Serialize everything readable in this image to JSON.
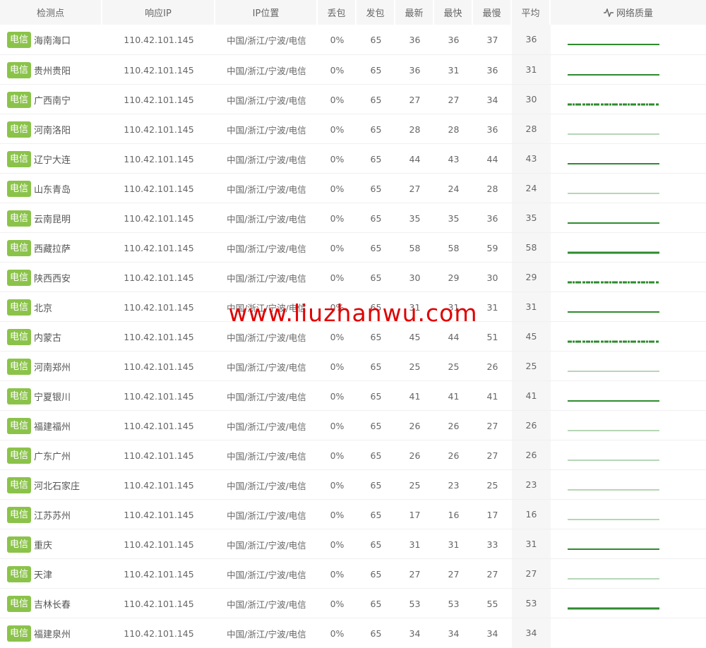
{
  "header": {
    "node": "检测点",
    "ip": "响应IP",
    "location": "IP位置",
    "loss": "丢包",
    "sent": "发包",
    "latest": "最新",
    "fastest": "最快",
    "slowest": "最慢",
    "average": "平均",
    "quality": "网络质量",
    "quality_icon": "pulse-icon"
  },
  "colors": {
    "badge": "#8bc34a",
    "quality_line": "#2e8b2e",
    "watermark": "#e00000",
    "header_bg": "#f6f6f6"
  },
  "watermark": "www.liuzhanwu.com",
  "rows": [
    {
      "isp": "电信",
      "node": "海南海口",
      "ip": "110.42.101.145",
      "location": "中国/浙江/宁波/电信",
      "loss": "0%",
      "sent": "65",
      "latest": "36",
      "fastest": "36",
      "slowest": "37",
      "average": "36",
      "quality": "solid"
    },
    {
      "isp": "电信",
      "node": "贵州贵阳",
      "ip": "110.42.101.145",
      "location": "中国/浙江/宁波/电信",
      "loss": "0%",
      "sent": "65",
      "latest": "36",
      "fastest": "31",
      "slowest": "36",
      "average": "31",
      "quality": "solid"
    },
    {
      "isp": "电信",
      "node": "广西南宁",
      "ip": "110.42.101.145",
      "location": "中国/浙江/宁波/电信",
      "loss": "0%",
      "sent": "65",
      "latest": "27",
      "fastest": "27",
      "slowest": "34",
      "average": "30",
      "quality": "jitter"
    },
    {
      "isp": "电信",
      "node": "河南洛阳",
      "ip": "110.42.101.145",
      "location": "中国/浙江/宁波/电信",
      "loss": "0%",
      "sent": "65",
      "latest": "28",
      "fastest": "28",
      "slowest": "36",
      "average": "28",
      "quality": "thin"
    },
    {
      "isp": "电信",
      "node": "辽宁大连",
      "ip": "110.42.101.145",
      "location": "中国/浙江/宁波/电信",
      "loss": "0%",
      "sent": "65",
      "latest": "44",
      "fastest": "43",
      "slowest": "44",
      "average": "43",
      "quality": "solid"
    },
    {
      "isp": "电信",
      "node": "山东青岛",
      "ip": "110.42.101.145",
      "location": "中国/浙江/宁波/电信",
      "loss": "0%",
      "sent": "65",
      "latest": "27",
      "fastest": "24",
      "slowest": "28",
      "average": "24",
      "quality": "thin"
    },
    {
      "isp": "电信",
      "node": "云南昆明",
      "ip": "110.42.101.145",
      "location": "中国/浙江/宁波/电信",
      "loss": "0%",
      "sent": "65",
      "latest": "35",
      "fastest": "35",
      "slowest": "36",
      "average": "35",
      "quality": "solid"
    },
    {
      "isp": "电信",
      "node": "西藏拉萨",
      "ip": "110.42.101.145",
      "location": "中国/浙江/宁波/电信",
      "loss": "0%",
      "sent": "65",
      "latest": "58",
      "fastest": "58",
      "slowest": "59",
      "average": "58",
      "quality": "thick"
    },
    {
      "isp": "电信",
      "node": "陕西西安",
      "ip": "110.42.101.145",
      "location": "中国/浙江/宁波/电信",
      "loss": "0%",
      "sent": "65",
      "latest": "30",
      "fastest": "29",
      "slowest": "30",
      "average": "29",
      "quality": "jitter"
    },
    {
      "isp": "电信",
      "node": "北京",
      "ip": "110.42.101.145",
      "location": "中国/浙江/宁波/电信",
      "loss": "0%",
      "sent": "65",
      "latest": "31",
      "fastest": "31",
      "slowest": "31",
      "average": "31",
      "quality": "solid"
    },
    {
      "isp": "电信",
      "node": "内蒙古",
      "ip": "110.42.101.145",
      "location": "中国/浙江/宁波/电信",
      "loss": "0%",
      "sent": "65",
      "latest": "45",
      "fastest": "44",
      "slowest": "51",
      "average": "45",
      "quality": "jitter"
    },
    {
      "isp": "电信",
      "node": "河南郑州",
      "ip": "110.42.101.145",
      "location": "中国/浙江/宁波/电信",
      "loss": "0%",
      "sent": "65",
      "latest": "25",
      "fastest": "25",
      "slowest": "26",
      "average": "25",
      "quality": "thin"
    },
    {
      "isp": "电信",
      "node": "宁夏银川",
      "ip": "110.42.101.145",
      "location": "中国/浙江/宁波/电信",
      "loss": "0%",
      "sent": "65",
      "latest": "41",
      "fastest": "41",
      "slowest": "41",
      "average": "41",
      "quality": "solid"
    },
    {
      "isp": "电信",
      "node": "福建福州",
      "ip": "110.42.101.145",
      "location": "中国/浙江/宁波/电信",
      "loss": "0%",
      "sent": "65",
      "latest": "26",
      "fastest": "26",
      "slowest": "27",
      "average": "26",
      "quality": "thin"
    },
    {
      "isp": "电信",
      "node": "广东广州",
      "ip": "110.42.101.145",
      "location": "中国/浙江/宁波/电信",
      "loss": "0%",
      "sent": "65",
      "latest": "26",
      "fastest": "26",
      "slowest": "27",
      "average": "26",
      "quality": "thin"
    },
    {
      "isp": "电信",
      "node": "河北石家庄",
      "ip": "110.42.101.145",
      "location": "中国/浙江/宁波/电信",
      "loss": "0%",
      "sent": "65",
      "latest": "25",
      "fastest": "23",
      "slowest": "25",
      "average": "23",
      "quality": "thin"
    },
    {
      "isp": "电信",
      "node": "江苏苏州",
      "ip": "110.42.101.145",
      "location": "中国/浙江/宁波/电信",
      "loss": "0%",
      "sent": "65",
      "latest": "17",
      "fastest": "16",
      "slowest": "17",
      "average": "16",
      "quality": "thin"
    },
    {
      "isp": "电信",
      "node": "重庆",
      "ip": "110.42.101.145",
      "location": "中国/浙江/宁波/电信",
      "loss": "0%",
      "sent": "65",
      "latest": "31",
      "fastest": "31",
      "slowest": "33",
      "average": "31",
      "quality": "solid"
    },
    {
      "isp": "电信",
      "node": "天津",
      "ip": "110.42.101.145",
      "location": "中国/浙江/宁波/电信",
      "loss": "0%",
      "sent": "65",
      "latest": "27",
      "fastest": "27",
      "slowest": "27",
      "average": "27",
      "quality": "thin"
    },
    {
      "isp": "电信",
      "node": "吉林长春",
      "ip": "110.42.101.145",
      "location": "中国/浙江/宁波/电信",
      "loss": "0%",
      "sent": "65",
      "latest": "53",
      "fastest": "53",
      "slowest": "55",
      "average": "53",
      "quality": "thick"
    },
    {
      "isp": "电信",
      "node": "福建泉州",
      "ip": "110.42.101.145",
      "location": "中国/浙江/宁波/电信",
      "loss": "0%",
      "sent": "65",
      "latest": "34",
      "fastest": "34",
      "slowest": "34",
      "average": "34",
      "quality": "none"
    }
  ]
}
